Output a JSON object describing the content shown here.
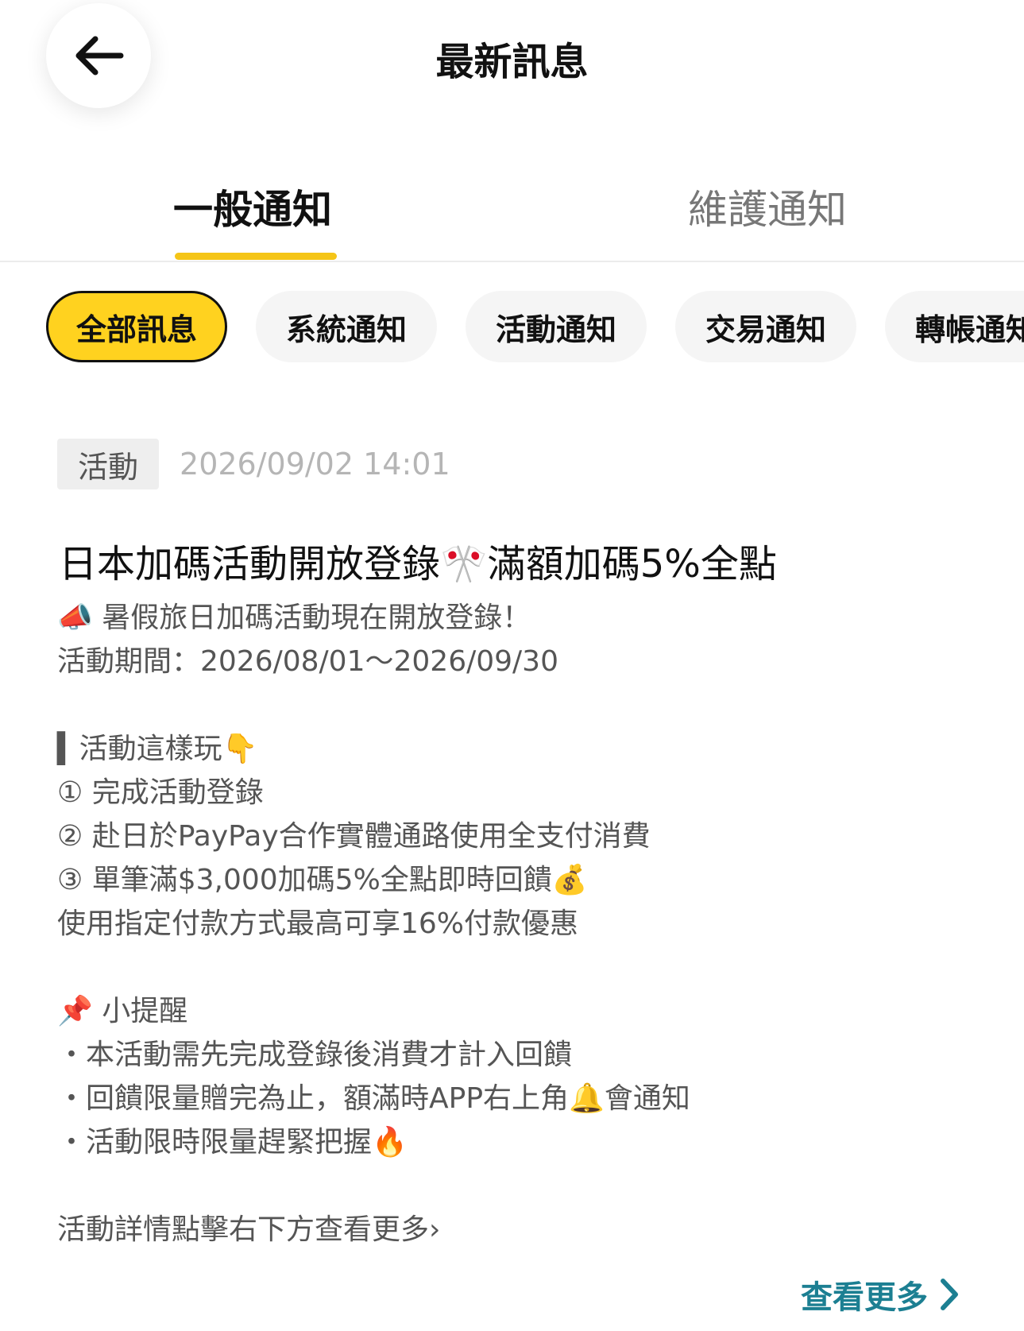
{
  "header": {
    "title": "最新訊息",
    "back_icon": "arrow-left-icon"
  },
  "tabs": [
    {
      "label": "一般通知",
      "active": true
    },
    {
      "label": "維護通知",
      "active": false
    }
  ],
  "accent_color": "#ffd21f",
  "link_color": "#1c7f92",
  "filters": [
    {
      "label": "全部訊息",
      "active": true
    },
    {
      "label": "系統通知",
      "active": false
    },
    {
      "label": "活動通知",
      "active": false
    },
    {
      "label": "交易通知",
      "active": false
    },
    {
      "label": "轉帳通知",
      "active": false
    }
  ],
  "message": {
    "tag": "活動",
    "date": "2026/09/02 14:01",
    "title": "日本加碼活動開放登錄🎌滿額加碼5%全點",
    "body": [
      "📣 暑假旅日加碼活動現在開放登錄！",
      "活動期間：2026/08/01～2026/09/30",
      "",
      "▍活動這樣玩👇",
      "① 完成活動登錄",
      "② 赴日於PayPay合作實體通路使用全支付消費",
      "③ 單筆滿$3,000加碼5%全點即時回饋💰",
      "使用指定付款方式最高可享16%付款優惠",
      "",
      "📌 小提醒",
      "・本活動需先完成登錄後消費才計入回饋",
      "・回饋限量贈完為止，額滿時APP右上角🔔會通知",
      "・活動限時限量趕緊把握🔥",
      "",
      "活動詳情點擊右下方查看更多›"
    ],
    "more_label": "查看更多",
    "more_icon": "chevron-right-icon"
  }
}
